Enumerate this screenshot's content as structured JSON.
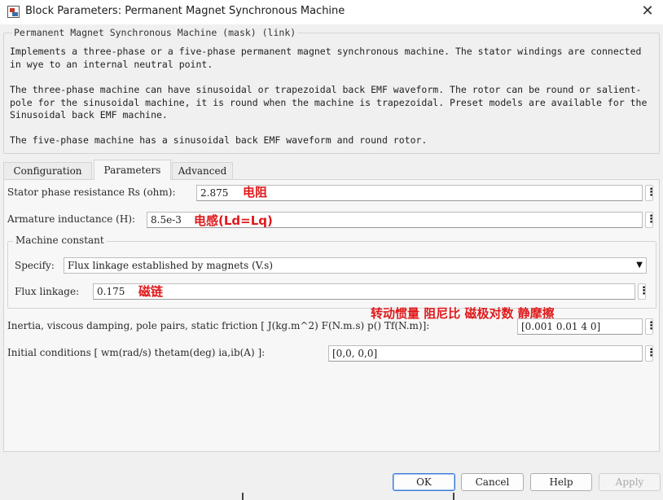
{
  "window": {
    "title": "Block Parameters: Permanent Magnet Synchronous Machine",
    "close_glyph": "✕"
  },
  "description": {
    "legend": "Permanent Magnet Synchronous Machine (mask) (link)",
    "paragraphs": [
      "Implements a three-phase or a five-phase permanent magnet synchronous machine. The stator windings are connected in wye to an internal neutral point.",
      "The three-phase machine can have sinusoidal or trapezoidal back EMF waveform. The rotor can be round or salient-pole for the sinusoidal machine, it is round when the machine is trapezoidal. Preset models are available for the Sinusoidal back EMF machine.",
      "The five-phase machine has a sinusoidal back EMF waveform and round rotor."
    ]
  },
  "tabs": [
    {
      "label": "Configuration",
      "active": false
    },
    {
      "label": "Parameters",
      "active": true
    },
    {
      "label": "Advanced",
      "active": false
    }
  ],
  "params": {
    "stator_resistance": {
      "label": "Stator phase resistance Rs (ohm):",
      "value": "2.875",
      "note": "电阻"
    },
    "armature_inductance": {
      "label": "Armature inductance (H):",
      "value": "8.5e-3",
      "note": "电感(Ld=Lq)"
    },
    "machine_constant": {
      "legend": "Machine constant",
      "specify_label": "Specify:",
      "specify_value": "Flux linkage established by magnets (V.s)",
      "flux_label": "Flux linkage:",
      "flux_value": "0.175",
      "flux_note": "磁链"
    },
    "inertia_notes": "转动惯量 阻尼比 磁极对数 静摩擦",
    "inertia": {
      "label": "Inertia, viscous damping, pole pairs, static friction [ J(kg.m^2) F(N.m.s) p() Tf(N.m)]:",
      "value": "[0.001 0.01 4 0]"
    },
    "initial": {
      "label": "Initial conditions [ wm(rad/s) thetam(deg) ia,ib(A) ]:",
      "value": "[0,0, 0,0]"
    }
  },
  "buttons": {
    "ok": "OK",
    "cancel": "Cancel",
    "help": "Help",
    "apply": "Apply"
  },
  "colors": {
    "annotation": "#e0191b",
    "accent": "#3b78d8"
  }
}
